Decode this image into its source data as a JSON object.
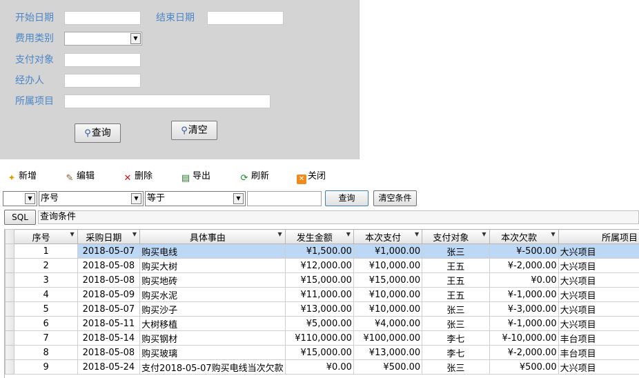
{
  "search": {
    "start_date_label": "开始日期",
    "end_date_label": "结束日期",
    "expense_type_label": "费用类别",
    "payee_label": "支付对象",
    "handler_label": "经办人",
    "project_label": "所属项目",
    "query_label": "查询",
    "clear_label": "清空"
  },
  "toolbar": {
    "new_label": "新增",
    "edit_label": "编辑",
    "delete_label": "删除",
    "export_label": "导出",
    "refresh_label": "刷新",
    "close_label": "关闭"
  },
  "filter": {
    "logic_value": "",
    "field_value": "序号",
    "operator_value": "等于",
    "condition_value": "",
    "query_label": "查询",
    "clear_conditions_label": "清空条件",
    "sql_label": "SQL",
    "query_conditions_label": "查询条件"
  },
  "grid": {
    "headers": [
      "序号",
      "采购日期",
      "具体事由",
      "发生金额",
      "本次支付",
      "支付对象",
      "本次欠款",
      "所属项目"
    ],
    "rows": [
      [
        "1",
        "2018-05-07",
        "购买电线",
        "¥1,500.00",
        "¥1,000.00",
        "张三",
        "¥-500.00",
        "大兴项目"
      ],
      [
        "2",
        "2018-05-08",
        "购买大树",
        "¥12,000.00",
        "¥10,000.00",
        "王五",
        "¥-2,000.00",
        "大兴项目"
      ],
      [
        "3",
        "2018-05-08",
        "购买地砖",
        "¥15,000.00",
        "¥15,000.00",
        "王五",
        "¥0.00",
        "大兴项目"
      ],
      [
        "4",
        "2018-05-09",
        "购买水泥",
        "¥11,000.00",
        "¥10,000.00",
        "王五",
        "¥-1,000.00",
        "大兴项目"
      ],
      [
        "5",
        "2018-05-07",
        "购买沙子",
        "¥13,000.00",
        "¥10,000.00",
        "张三",
        "¥-3,000.00",
        "大兴项目"
      ],
      [
        "6",
        "2018-05-11",
        "大树移植",
        "¥5,000.00",
        "¥4,000.00",
        "张三",
        "¥-1,000.00",
        "大兴项目"
      ],
      [
        "7",
        "2018-05-14",
        "购买钢材",
        "¥110,000.00",
        "¥100,000.00",
        "李七",
        "¥-10,000.00",
        "丰台项目"
      ],
      [
        "8",
        "2018-05-08",
        "购买玻璃",
        "¥15,000.00",
        "¥13,000.00",
        "李七",
        "¥-2,000.00",
        "丰台项目"
      ],
      [
        "9",
        "2018-05-24",
        "支付2018-05-07购买电线当次欠款",
        "¥0.00",
        "¥500.00",
        "张三",
        "¥500.00",
        "大兴项目"
      ]
    ],
    "selected_row": 0
  },
  "colors": {
    "label_blue": "#4b86c8",
    "panel_gray": "#d4d4d4",
    "selection": "#bcd8f4"
  }
}
